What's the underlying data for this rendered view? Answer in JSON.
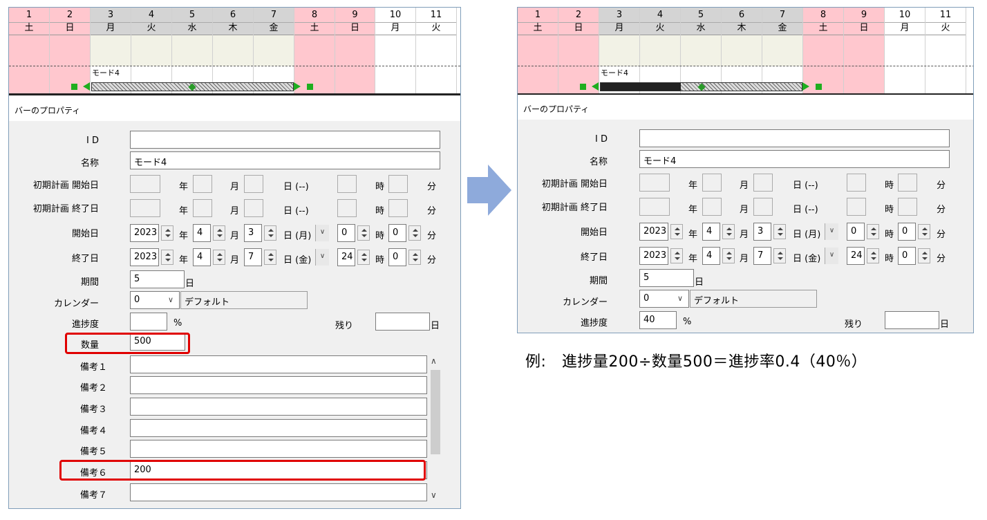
{
  "days": [
    {
      "num": "1",
      "dow": "土",
      "type": "we"
    },
    {
      "num": "2",
      "dow": "日",
      "type": "we"
    },
    {
      "num": "3",
      "dow": "月",
      "type": "wd"
    },
    {
      "num": "4",
      "dow": "火",
      "type": "wd"
    },
    {
      "num": "5",
      "dow": "水",
      "type": "wd"
    },
    {
      "num": "6",
      "dow": "木",
      "type": "wd"
    },
    {
      "num": "7",
      "dow": "金",
      "type": "wd"
    },
    {
      "num": "8",
      "dow": "土",
      "type": "we"
    },
    {
      "num": "9",
      "dow": "日",
      "type": "we"
    },
    {
      "num": "10",
      "dow": "月",
      "type": "nx"
    },
    {
      "num": "11",
      "dow": "火",
      "type": "nx"
    }
  ],
  "bar_label": "モード4",
  "right_bar_progress": 0.4,
  "panel_title": "バーのプロパティ",
  "labels": {
    "id": "I D",
    "name": "名称",
    "init_start": "初期計画 開始日",
    "init_end": "初期計画 終了日",
    "start": "開始日",
    "end": "終了日",
    "period": "期間",
    "calendar": "カレンダー",
    "progress": "進捗度",
    "quantity": "数量",
    "remain": "残り",
    "note1": "備考１",
    "note2": "備考２",
    "note3": "備考３",
    "note4": "備考４",
    "note5": "備考５",
    "note6": "備考６",
    "note7": "備考７"
  },
  "units": {
    "year": "年",
    "month": "月",
    "day_blank": "日 (--)",
    "hour": "時",
    "minute": "分",
    "day": "日",
    "percent": "%"
  },
  "values": {
    "name": "モード4",
    "start_year": "2023",
    "start_month": "4",
    "start_day": "3",
    "start_dow": "日 (月)",
    "start_hour": "0",
    "start_min": "0",
    "end_year": "2023",
    "end_month": "4",
    "end_day": "7",
    "end_dow": "日 (金)",
    "end_hour": "24",
    "end_min": "0",
    "period": "5",
    "calendar_code": "0",
    "calendar_name": "デフォルト",
    "progress_left": "",
    "progress_right": "40",
    "quantity": "500",
    "note6": "200"
  },
  "caption": "例:　進捗量200÷数量500＝進捗率0.4（40％）",
  "colors": {
    "weekend": "#ffc7ce",
    "highlight": "#e00000",
    "arrow": "#8eaadb",
    "handle": "#1fae1f"
  }
}
